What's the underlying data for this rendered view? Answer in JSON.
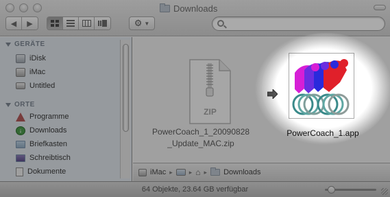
{
  "window": {
    "title": "Downloads"
  },
  "toolbar": {
    "back_icon": "chevron-left-icon",
    "forward_icon": "chevron-right-icon",
    "view_modes": [
      "icon-view",
      "list-view",
      "column-view",
      "coverflow-view"
    ],
    "active_view": "icon-view",
    "action_icon": "gear-icon",
    "search": {
      "placeholder": "",
      "value": ""
    }
  },
  "sidebar": {
    "sections": [
      {
        "label": "GERÄTE",
        "items": [
          {
            "label": "iDisk",
            "icon": "idisk-icon"
          },
          {
            "label": "iMac",
            "icon": "imac-icon"
          },
          {
            "label": "Untitled",
            "icon": "drive-icon"
          }
        ]
      },
      {
        "label": "ORTE",
        "items": [
          {
            "label": "Programme",
            "icon": "applications-icon"
          },
          {
            "label": "Downloads",
            "icon": "downloads-icon"
          },
          {
            "label": "Briefkasten",
            "icon": "folder-icon"
          },
          {
            "label": "Schreibtisch",
            "icon": "desktop-icon"
          },
          {
            "label": "Dokumente",
            "icon": "documents-icon"
          }
        ]
      }
    ]
  },
  "files": [
    {
      "name_line1": "PowerCoach_1_20090828",
      "name_line2": "_Update_MAC.zip",
      "icon": "zip-icon",
      "icon_label": "ZIP"
    },
    {
      "name": "PowerCoach_1.app",
      "icon": "app-icon"
    }
  ],
  "pathbar": {
    "crumbs": [
      "iMac",
      "",
      "",
      "Downloads"
    ]
  },
  "status": {
    "text": "64 Objekte, 23.64 GB verfügbar",
    "icon_size_level": 0.12
  },
  "colors": {
    "sidebar_bg": "#dde3e9",
    "app_magenta": "#d61fd6",
    "app_blue": "#2a2adc",
    "app_red": "#e0202a",
    "app_teal": "#2e8c8c"
  }
}
